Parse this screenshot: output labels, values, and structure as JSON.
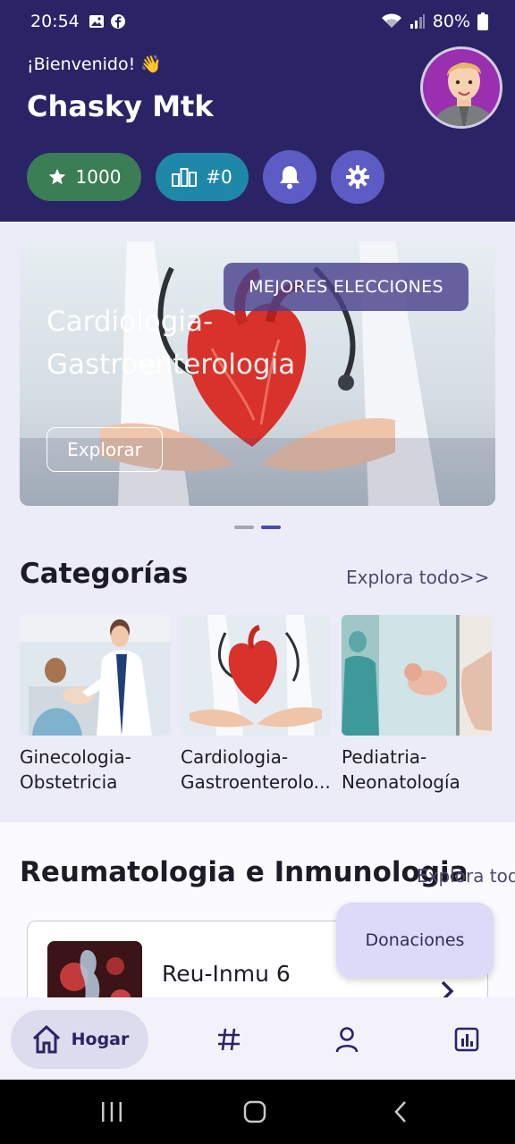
{
  "status_bar": {
    "time": "20:54",
    "battery": "80%"
  },
  "header": {
    "welcome": "¡Bienvenido! 👋",
    "user_name": "Chasky Mtk",
    "points": "1000",
    "rank": "#0"
  },
  "banner": {
    "tag": "MEJORES ELECCIONES",
    "title": "Cardiologia-Gastroenterologia",
    "explore_label": "Explorar",
    "active_page": 2,
    "page_count": 2
  },
  "categories": {
    "title": "Categorías",
    "see_all": "Explora todo>>",
    "items": [
      {
        "name_line1": "Ginecologia-",
        "name_line2": "Obstetricia"
      },
      {
        "name_line1": "Cardiologia-",
        "name_line2": "Gastroenterolo..."
      },
      {
        "name_line1": "Pediatria-",
        "name_line2": "Neonatología"
      }
    ]
  },
  "section2": {
    "title": "Reumatologia e Inmunologia",
    "see_all": "Explora tod",
    "course_title": "Reu-Inmu 6"
  },
  "donation_label": "Donaciones",
  "bottom_nav": {
    "home_label": "Hogar"
  },
  "colors": {
    "header_bg": "#2a2467",
    "points_chip": "#3b7d55",
    "rank_chip": "#1f88a8",
    "round_buttons": "#5d5bc4",
    "page_bg": "#ecebf8"
  }
}
